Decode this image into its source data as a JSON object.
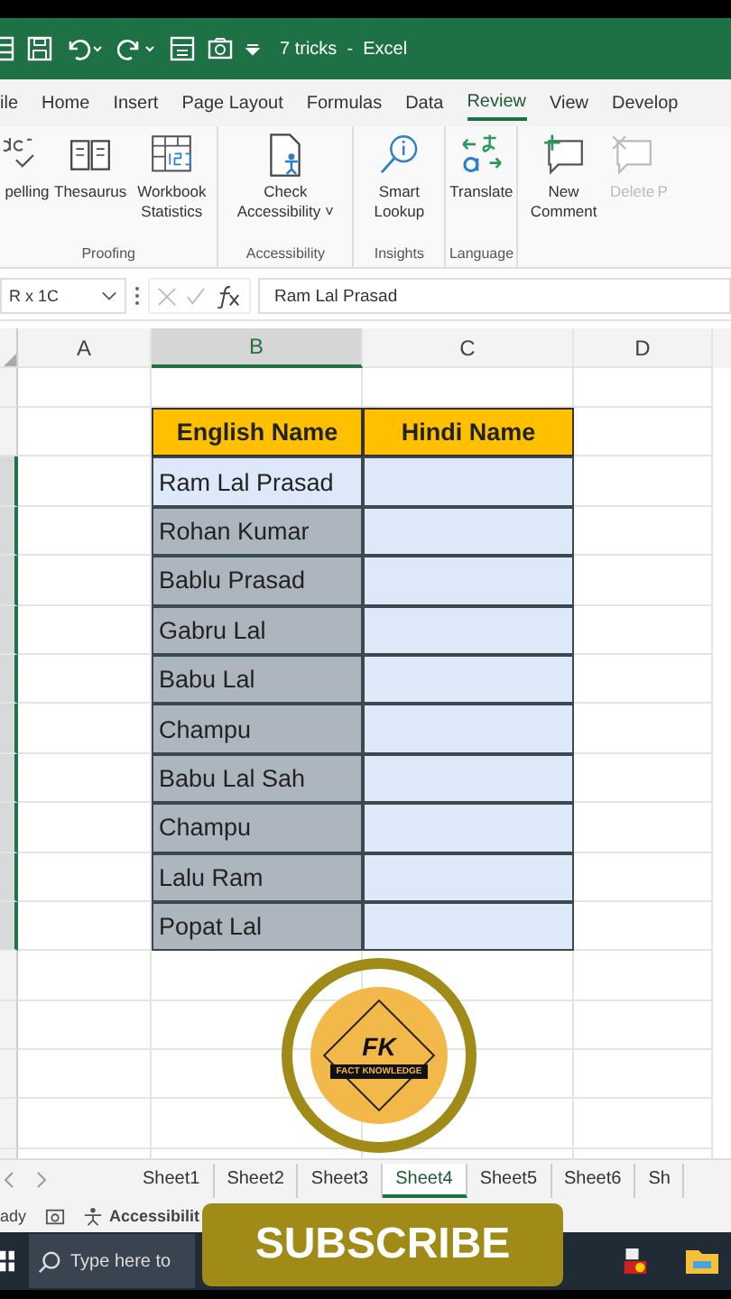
{
  "window": {
    "title": "7 tricks  -  Excel"
  },
  "menu_tabs": [
    {
      "label": "ile",
      "selected": false
    },
    {
      "label": "Home",
      "selected": false
    },
    {
      "label": "Insert",
      "selected": false
    },
    {
      "label": "Page Layout",
      "selected": false
    },
    {
      "label": "Formulas",
      "selected": false
    },
    {
      "label": "Data",
      "selected": false
    },
    {
      "label": "Review",
      "selected": true
    },
    {
      "label": "View",
      "selected": false
    },
    {
      "label": "Develop",
      "selected": false
    }
  ],
  "ribbon_groups": [
    {
      "label": "Proofing",
      "buttons": [
        {
          "kind": "spelling",
          "label": "pelling",
          "disabled": false
        },
        {
          "kind": "thesaurus",
          "label": "Thesaurus",
          "disabled": false
        },
        {
          "kind": "statistics",
          "label": "Workbook Statistics",
          "disabled": false
        }
      ]
    },
    {
      "label": "Accessibility",
      "buttons": [
        {
          "kind": "accessibility",
          "label": "Check Accessibility ˅",
          "disabled": false
        }
      ]
    },
    {
      "label": "Insights",
      "buttons": [
        {
          "kind": "lookup",
          "label": "Smart Lookup",
          "disabled": false
        }
      ]
    },
    {
      "label": "Language",
      "buttons": [
        {
          "kind": "translate",
          "label": "Translate",
          "disabled": false
        }
      ]
    },
    {
      "buttons": [
        {
          "kind": "comment",
          "label": "New Comment",
          "disabled": false
        },
        {
          "kind": "delete",
          "label": "Delete",
          "disabled": true
        },
        {
          "kind": "cut",
          "label": "P",
          "disabled": true
        }
      ]
    }
  ],
  "formula_bar": {
    "name_box": "R x 1C",
    "value": "Ram Lal Prasad"
  },
  "columns": [
    {
      "label": "A",
      "selected": false
    },
    {
      "label": "B",
      "selected": true
    },
    {
      "label": "C",
      "selected": false
    },
    {
      "label": "D",
      "selected": false
    }
  ],
  "table": {
    "headers": [
      "English Name",
      "Hindi Name"
    ],
    "rows": [
      {
        "english": "Ram Lal Prasad",
        "active": true
      },
      {
        "english": "Rohan Kumar",
        "active": false
      },
      {
        "english": "Bablu Prasad",
        "active": false
      },
      {
        "english": "Gabru Lal",
        "active": false
      },
      {
        "english": "Babu Lal",
        "active": false
      },
      {
        "english": "Champu",
        "active": false
      },
      {
        "english": "Babu Lal Sah",
        "active": false
      },
      {
        "english": "Champu",
        "active": false
      },
      {
        "english": "Lalu Ram",
        "active": false
      },
      {
        "english": "Popat Lal",
        "active": false
      }
    ]
  },
  "sheet_tabs": [
    {
      "label": "Sheet1",
      "selected": false
    },
    {
      "label": "Sheet2",
      "selected": false
    },
    {
      "label": "Sheet3",
      "selected": false
    },
    {
      "label": "Sheet4",
      "selected": true
    },
    {
      "label": "Sheet5",
      "selected": false
    },
    {
      "label": "Sheet6",
      "selected": false
    },
    {
      "label": "Sh",
      "selected": false
    }
  ],
  "status_bar": {
    "mode": "ady",
    "accessibility": "Accessibilit"
  },
  "taskbar": {
    "search_placeholder": "Type here to"
  },
  "overlay": {
    "logo_initials": "FK",
    "logo_caption": "FACT KNOWLEDGE",
    "button": "SUBSCRIBE"
  }
}
